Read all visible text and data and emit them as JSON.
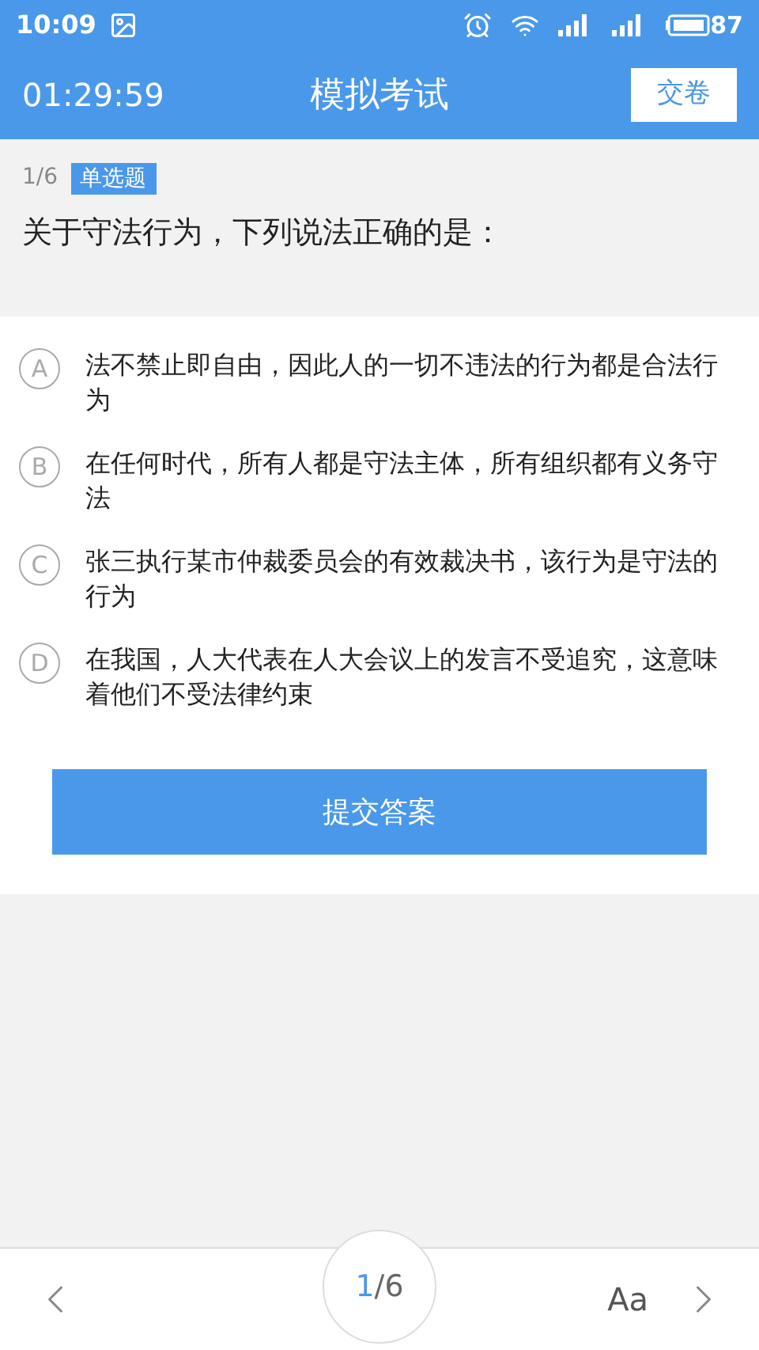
{
  "status_bar": {
    "time": "10:09",
    "battery": "87"
  },
  "header": {
    "timer": "01:29:59",
    "title": "模拟考试",
    "submit_button": "交卷"
  },
  "question": {
    "counter": "1/6",
    "type_tag": "单选题",
    "text": "关于守法行为，下列说法正确的是："
  },
  "options": [
    {
      "letter": "A",
      "text": "法不禁止即自由，因此人的一切不违法的行为都是合法行为",
      "selected": false
    },
    {
      "letter": "B",
      "text": "在任何时代，所有人都是守法主体，所有组织都有义务守法",
      "selected": false
    },
    {
      "letter": "C",
      "text": "张三执行某市仲裁委员会的有效裁决书，该行为是守法的行为",
      "selected": false
    },
    {
      "letter": "D",
      "text": "在我国，人大代表在人大会议上的发言不受追究，这意味着他们不受法律约束",
      "selected": false
    }
  ],
  "answer_button": "提交答案",
  "bottom_bar": {
    "current": "1",
    "total": "/6",
    "font_button": "Aa"
  }
}
